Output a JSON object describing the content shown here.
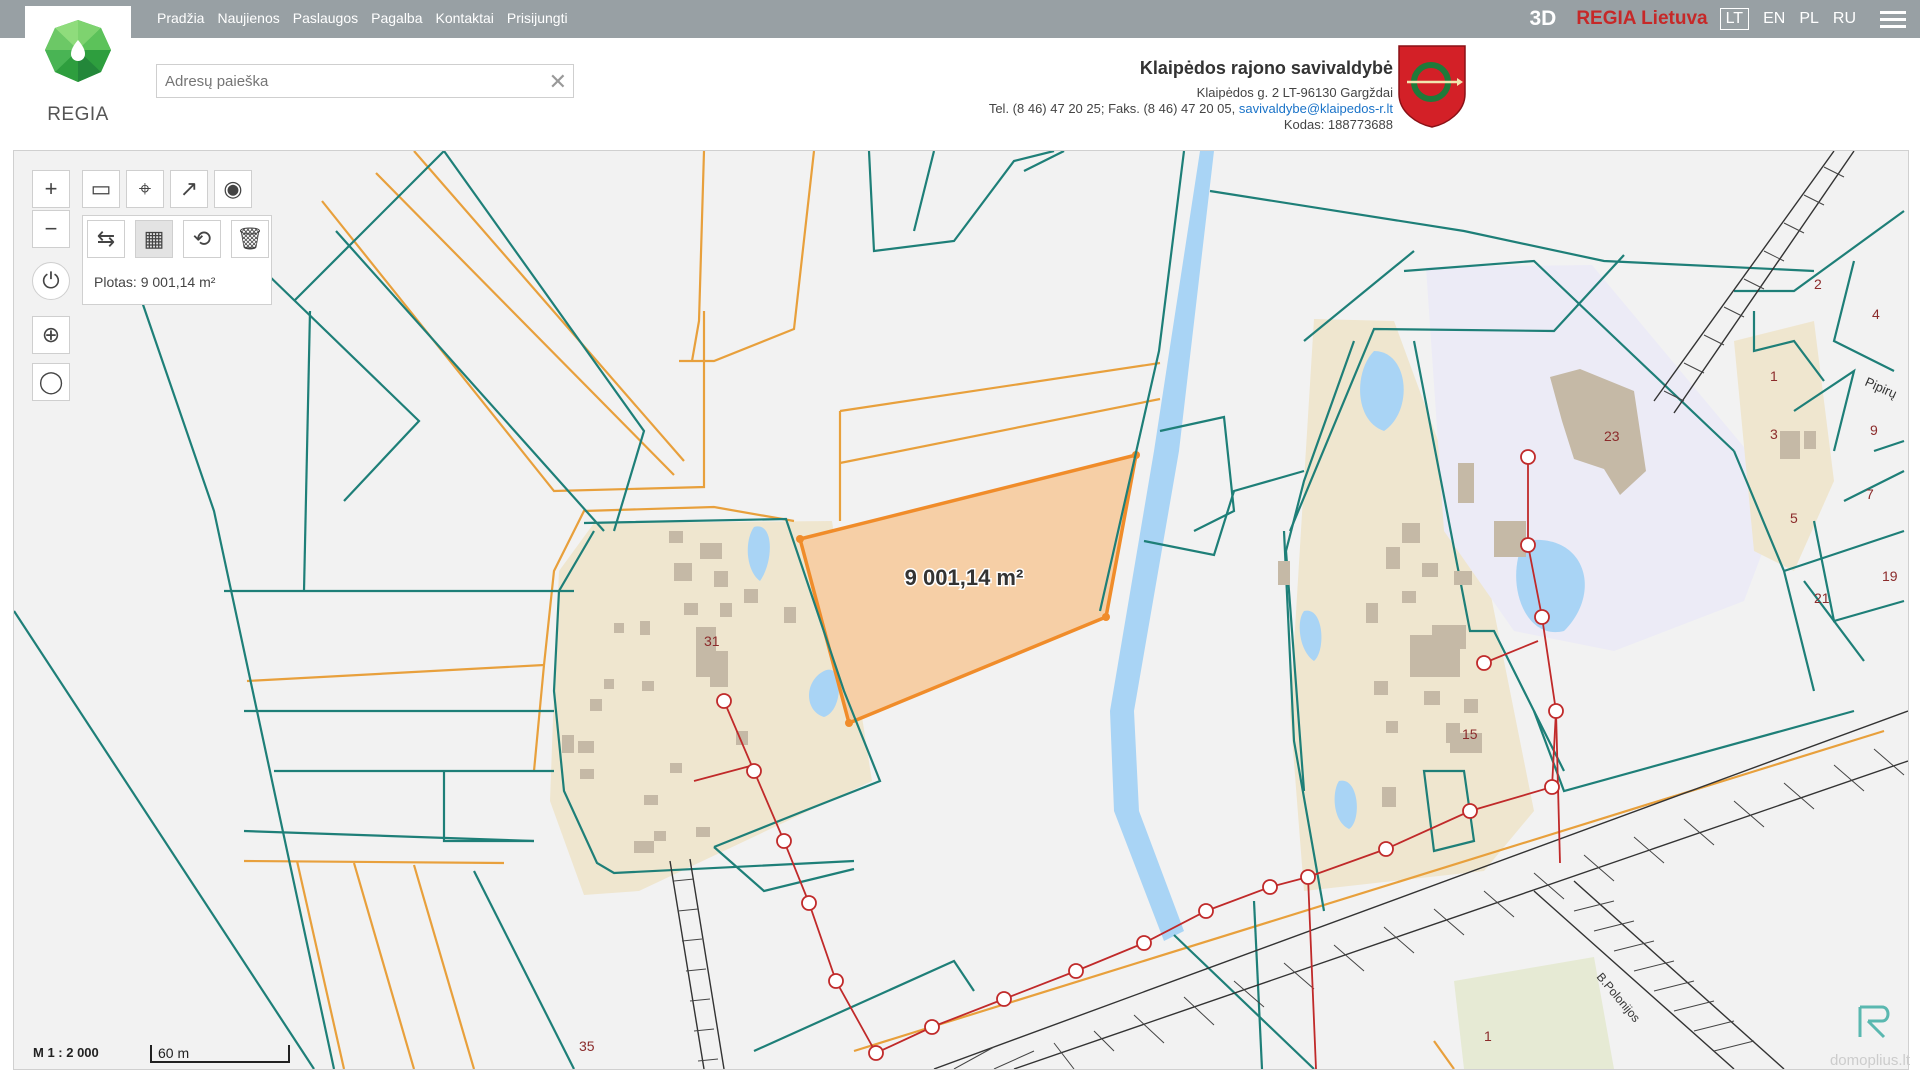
{
  "nav": [
    "Pradžia",
    "Naujienos",
    "Paslaugos",
    "Pagalba",
    "Kontaktai",
    "Prisijungti"
  ],
  "logo_text": "REGIA",
  "top_right": {
    "view_3d": "3D",
    "brand": "REGIA Lietuva",
    "languages": [
      "LT",
      "EN",
      "PL",
      "RU"
    ],
    "active_language": "LT"
  },
  "search": {
    "placeholder": "Adresų paieška",
    "value": ""
  },
  "municipality": {
    "name": "Klaipėdos rajono savivaldybė",
    "address": "Klaipėdos g. 2 LT-96130 Gargždai",
    "phone": "Tel. (8 46) 47 20 25; Faks. (8 46) 47 20 05,",
    "email": "savivaldybe@klaipedos-r.lt",
    "code": "Kodas: 188773688"
  },
  "measure": {
    "area_label": "Plotas: 9 001,14 m²",
    "polygon_label": "9 001,14 m²"
  },
  "map_labels": {
    "parcel_31": "31",
    "parcel_35": "35",
    "parcel_23": "23",
    "parcel_15": "15",
    "plot_2": "2",
    "plot_4": "4",
    "plot_1": "1",
    "plot_3": "3",
    "plot_9": "9",
    "plot_7": "7",
    "plot_5": "5",
    "plot_19": "19",
    "plot_21": "21",
    "plot_1b": "1",
    "street_pipiru": "Pipirų",
    "street_b": "B.Polonijos"
  },
  "scale": {
    "ratio": "M 1 : 2 000",
    "bar": "60 m"
  },
  "watermark": "domoplius.lt",
  "colors": {
    "topbar": "#98a0a4",
    "parcel_line": "#1e7f78",
    "orange_line": "#e8a03c",
    "measure_fill": "#f6cfa6",
    "measure_stroke": "#f08c2a",
    "water": "#a9d4f5",
    "settlement": "#efe6cf",
    "building": "#c5b9a6",
    "utility": "#c02a2a"
  }
}
